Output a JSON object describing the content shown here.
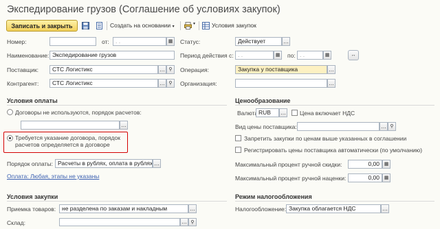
{
  "window": {
    "title": "Экспедирование грузов (Соглашение об условиях закупок)"
  },
  "toolbar": {
    "save_close_label": "Записать и закрыть",
    "create_based_label": "Создать на основании",
    "purchase_conditions_label": "Условия закупок"
  },
  "header": {
    "number_label": "Номер:",
    "number_value": "",
    "from_label": "от:",
    "from_value": ". .",
    "status_label": "Статус:",
    "status_value": "Действует",
    "name_label": "Наименование:",
    "name_value": "Экспедирование грузов",
    "period_label": "Период действия с:",
    "period_from_value": ". .",
    "period_to_label": "по:",
    "period_to_value": ". .",
    "supplier_label": "Поставщик:",
    "supplier_value": "СТС Логистикс",
    "operation_label": "Операция:",
    "operation_value": "Закупка у поставщика",
    "counterparty_label": "Контрагент:",
    "counterparty_value": "СТС Логистикс",
    "organization_label": "Организация:",
    "organization_value": ""
  },
  "payment": {
    "section_title": "Условия оплаты",
    "option1_label": "Договоры не используются, порядок расчетов:",
    "option1_value": "",
    "option2_line1": "Требуется указание договора, порядок",
    "option2_line2": "расчетов определяется в договоре",
    "order_label": "Порядок оплаты:",
    "order_value": "Расчеты в рублях, оплата в рублях",
    "payment_link": "Оплата: Любая, этапы не указаны"
  },
  "pricing": {
    "section_title": "Ценообразование",
    "currency_label": "Валюта:",
    "currency_value": "RUB",
    "vat_included_label": "Цена включает НДС",
    "supplier_price_label": "Вид цены поставщика:",
    "supplier_price_value": "",
    "forbid_label": "Запретить закупки по ценам выше указанных в соглашении",
    "register_label": "Регистрировать цены поставщика автоматически (по умолчанию)",
    "max_discount_label": "Максимальный процент ручной скидки:",
    "max_discount_value": "0,00",
    "max_markup_label": "Максимальный процент ручной наценки:",
    "max_markup_value": "0,00"
  },
  "purchase": {
    "section_title": "Условия закупки",
    "acceptance_label": "Приемка товаров:",
    "acceptance_value": "не разделена по заказам и накладным",
    "warehouse_label": "Склад:",
    "warehouse_value": ""
  },
  "tax": {
    "section_title": "Режим налогообложения",
    "tax_label": "Налогообложение:",
    "tax_value": "Закупка облагается НДС"
  },
  "colors": {
    "accent_button": "#f2d15c",
    "highlight_border": "#d40000",
    "link": "#3a5fb0",
    "yellow_field": "#fdf1c2"
  }
}
